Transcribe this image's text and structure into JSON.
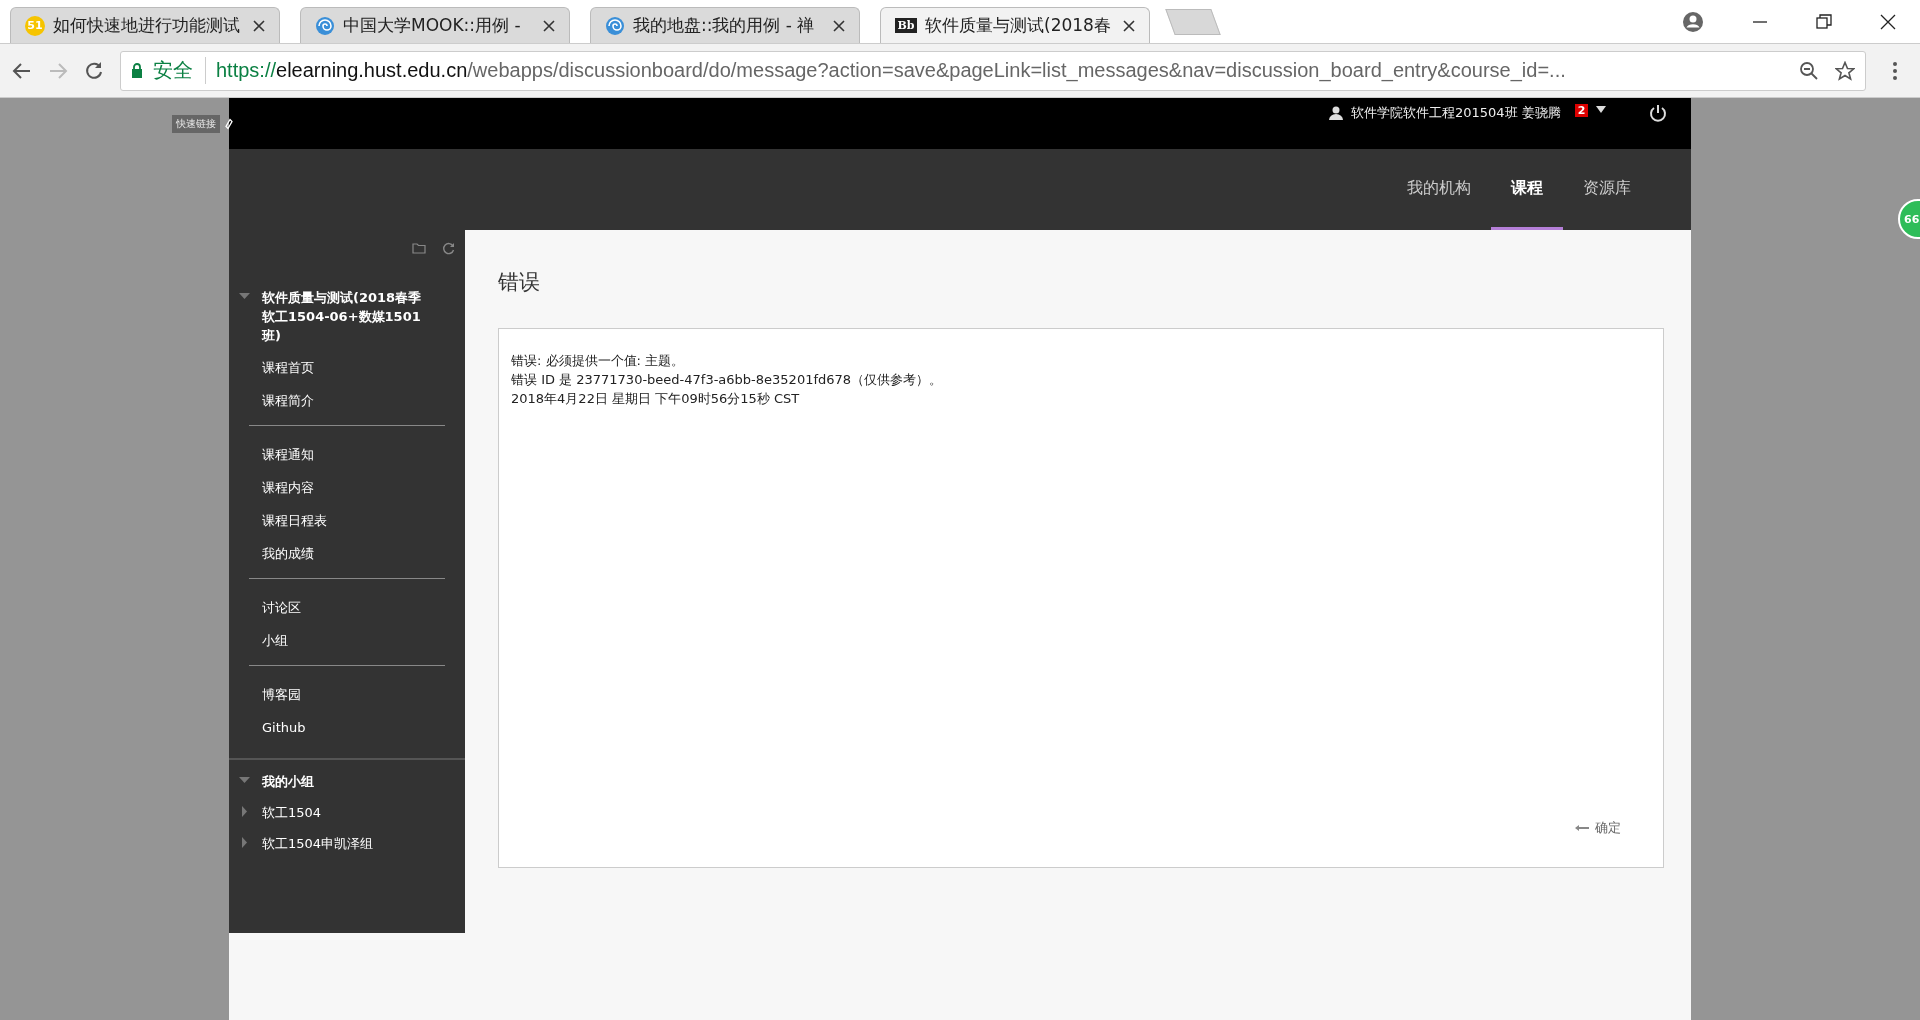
{
  "browser": {
    "tabs": [
      {
        "title": "如何快速地进行功能测试",
        "kind": "badge",
        "icon_text": "51",
        "selected": false
      },
      {
        "title": "中国大学MOOK::用例 -",
        "kind": "globe",
        "selected": false
      },
      {
        "title": "我的地盘::我的用例 - 禅",
        "kind": "globe",
        "selected": false
      },
      {
        "title": "软件质量与测试(2018春",
        "kind": "logo",
        "icon_text": "Bb",
        "selected": true
      }
    ],
    "secure_label": "安全",
    "url": {
      "scheme": "https://",
      "host": "elearning.hust.edu.cn",
      "path": "/webapps/discussionboard/do/message?action=save&pageLink=list_messages&nav=discussion_board_entry&course_id=..."
    }
  },
  "quick_links": "快速链接",
  "header": {
    "user": "软件学院软件工程201504班 姜骁腾",
    "badge": "2"
  },
  "nav": [
    {
      "label": "我的机构",
      "selected": false
    },
    {
      "label": "课程",
      "selected": true
    },
    {
      "label": "资源库",
      "selected": false
    }
  ],
  "sidebar": {
    "course": {
      "title": "软件质量与测试(2018春季软工1504-06+数媒1501班)",
      "expanded": true,
      "groups": [
        [
          "课程首页",
          "课程简介"
        ],
        [
          "课程通知",
          "课程内容",
          "课程日程表",
          "我的成绩"
        ],
        [
          "讨论区",
          "小组"
        ],
        [
          "博客园",
          "Github"
        ]
      ]
    },
    "my_groups": {
      "title": "我的小组",
      "expanded": true,
      "children": [
        {
          "label": "软工1504",
          "expanded": false
        },
        {
          "label": "软工1504申凯泽组",
          "expanded": false
        }
      ]
    }
  },
  "page_title": "错误",
  "messages": [
    "错误: 必须提供一个值: 主题。",
    "错误 ID 是 23771730-beed-47f3-a6bb-8e35201fd678（仅供参考）。",
    "2018年4月22日 星期日 下午09时56分15秒 CST"
  ],
  "ok_button": "确定",
  "side_badge": "66"
}
